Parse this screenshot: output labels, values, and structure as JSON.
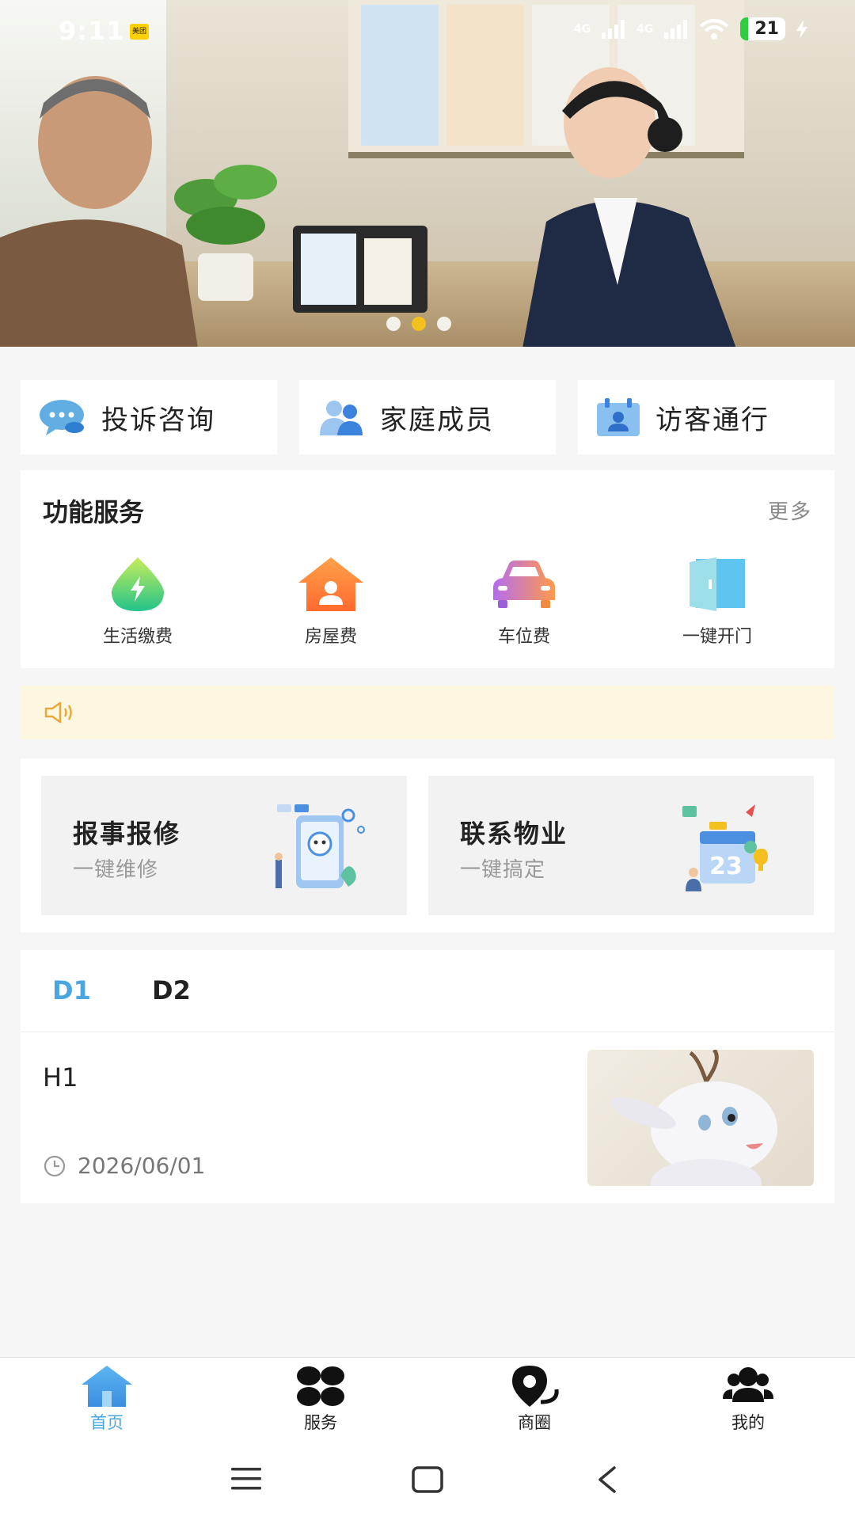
{
  "status_bar": {
    "time": "9:11",
    "app_badge": "美团",
    "network_1": "4G",
    "network_2": "4G",
    "battery": "21"
  },
  "banner": {
    "active_slide": 2,
    "slide_count": 3
  },
  "quick_actions": [
    {
      "label": "投诉咨询",
      "icon": "chat-bubble-icon"
    },
    {
      "label": "家庭成员",
      "icon": "family-members-icon"
    },
    {
      "label": "访客通行",
      "icon": "visitor-pass-icon"
    }
  ],
  "function_services": {
    "title": "功能服务",
    "more": "更多",
    "items": [
      {
        "label": "生活缴费",
        "icon": "utility-payment-icon"
      },
      {
        "label": "房屋费",
        "icon": "house-fee-icon"
      },
      {
        "label": "车位费",
        "icon": "parking-fee-icon"
      },
      {
        "label": "一键开门",
        "icon": "door-open-icon"
      }
    ]
  },
  "notice": {
    "icon": "speaker-icon"
  },
  "service_cards": [
    {
      "title": "报事报修",
      "subtitle": "一键维修"
    },
    {
      "title": "联系物业",
      "subtitle": "一键搞定"
    }
  ],
  "news": {
    "tabs": [
      "D1",
      "D2"
    ],
    "active_tab": "D1",
    "article": {
      "title": "H1",
      "date": "2026/06/01"
    }
  },
  "bottom_nav": [
    {
      "label": "首页",
      "icon": "home-icon",
      "active": true
    },
    {
      "label": "服务",
      "icon": "services-grid-icon"
    },
    {
      "label": "商圈",
      "icon": "business-district-icon"
    },
    {
      "label": "我的",
      "icon": "profile-icon"
    }
  ],
  "colors": {
    "accent": "#4aa6de",
    "notice_bg": "#fdf7e1",
    "dot_active": "#f4c020"
  }
}
